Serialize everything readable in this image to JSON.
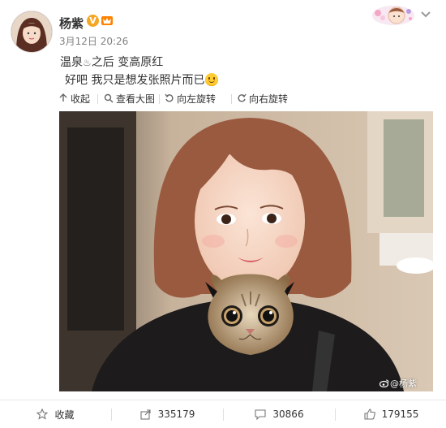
{
  "user": {
    "name": "杨紫",
    "verified_mark": "V",
    "time": "3月12日 20:26"
  },
  "post": {
    "line1_a": "温泉",
    "line1_b": "之后 变高原红",
    "line2": "好吧 我只是想发张照片而已",
    "hotspring_icon": "♨"
  },
  "image_toolbar": {
    "collapse": "收起",
    "view_large": "查看大图",
    "rotate_left": "向左旋转",
    "rotate_right": "向右旋转"
  },
  "image": {
    "watermark": "@杨紫"
  },
  "actions": {
    "favorite": "收藏",
    "share": "335179",
    "comment": "30866",
    "like": "179155"
  },
  "colors": {
    "link": "#333333",
    "muted": "#808080",
    "verified": "#f5a623"
  }
}
